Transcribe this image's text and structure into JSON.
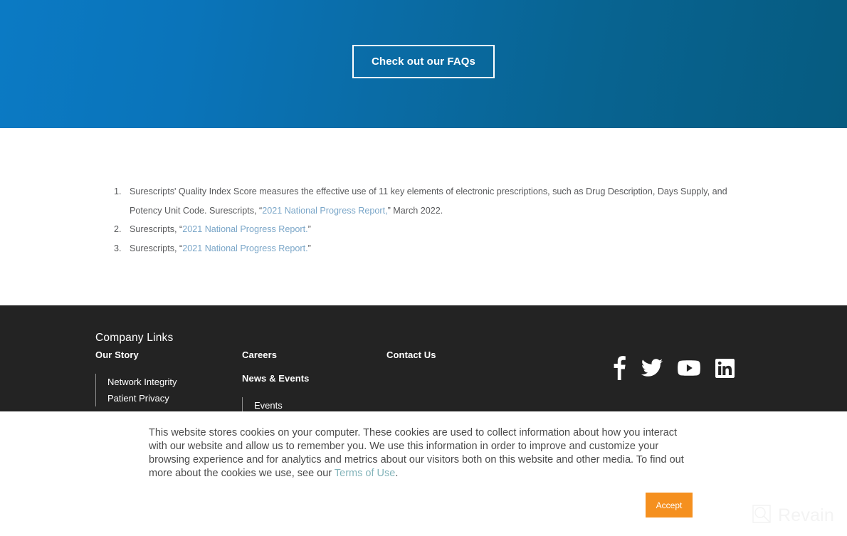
{
  "hero": {
    "cta_label": "Check out our FAQs",
    "gradient_start": "#0b7ac4",
    "gradient_end": "#065b80"
  },
  "footnotes": {
    "items": [
      {
        "number": "1.",
        "text_before": "Surescripts' Quality Index Score measures the effective use of 11 key elements of electronic prescriptions, such as Drug Description, Days Supply, and Potency Unit Code. Surescripts, “",
        "link": "2021 National Progress Report,",
        "text_after": "” March 2022."
      },
      {
        "number": "2.",
        "text_before": "Surescripts, “",
        "link": "2021 National Progress Report.",
        "text_after": "”"
      },
      {
        "number": "3.",
        "text_before": "Surescripts, “",
        "link": "2021 National Progress Report.",
        "text_after": "”"
      }
    ],
    "link_color": "#7aa6c8",
    "text_color": "#58595b"
  },
  "footer": {
    "background": "#232323",
    "title": "Company Links",
    "columns": [
      {
        "heading": "Our Story",
        "sub_items": [
          "Network Integrity",
          "Patient Privacy"
        ]
      },
      {
        "heading": "Careers",
        "heading2": "News & Events",
        "sub_items": [
          "Events"
        ]
      },
      {
        "heading": "Contact Us",
        "sub_items": []
      }
    ],
    "socials": [
      {
        "name": "facebook",
        "icon": "facebook-icon",
        "label": "Facebook"
      },
      {
        "name": "twitter",
        "icon": "twitter-icon",
        "label": "Twitter"
      },
      {
        "name": "youtube",
        "icon": "youtube-icon",
        "label": "YouTube"
      },
      {
        "name": "linkedin",
        "icon": "linkedin-icon",
        "label": "LinkedIn"
      }
    ]
  },
  "cookie_banner": {
    "text_before": "This website stores cookies on your computer. These cookies are used to collect information about how you interact with our website and allow us to remember you. We use this information in order to improve and customize your browsing experience and for analytics and metrics about our visitors both on this website and other media. To find out more about the cookies we use, see our ",
    "link": "Terms of Use",
    "text_after": ".",
    "accept_label": "Accept",
    "accept_color": "#f5901f",
    "link_color": "#84b4ba"
  },
  "watermark": {
    "text": "Revain",
    "icon": "revain-logo-icon"
  }
}
